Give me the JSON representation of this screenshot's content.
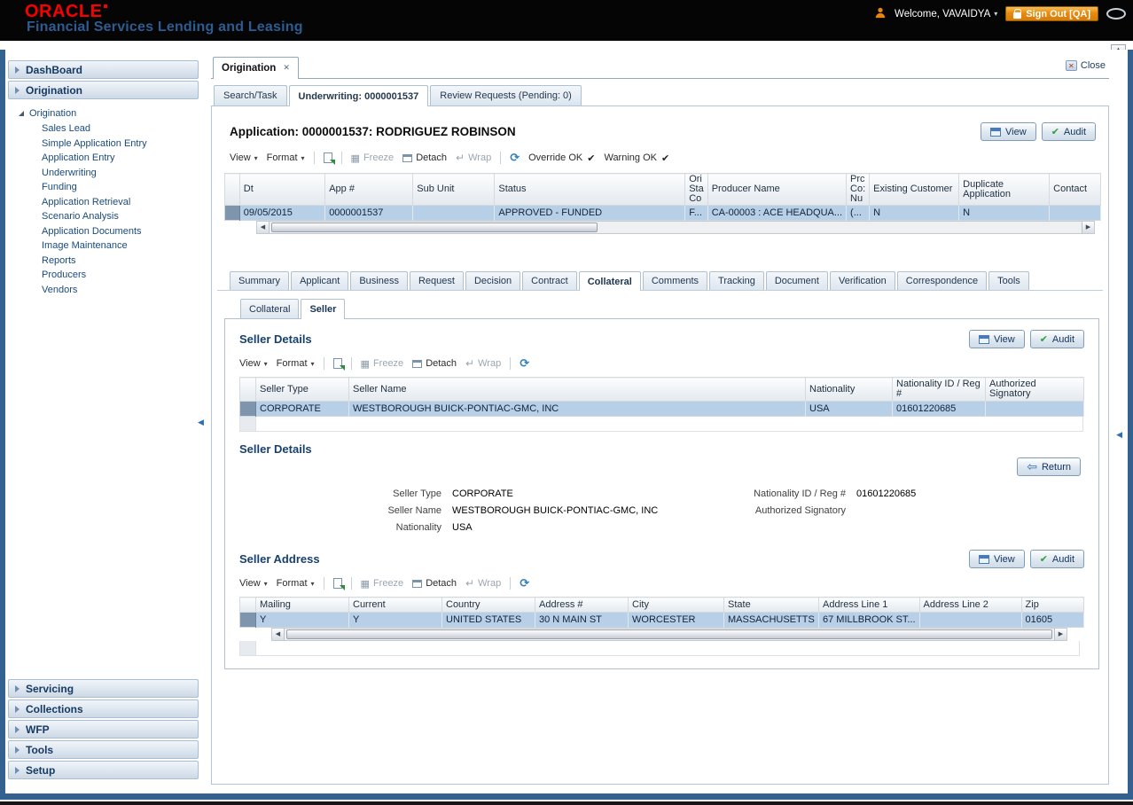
{
  "header": {
    "logo": "ORACLE",
    "product_line": "Financial Services Lending and Leasing",
    "welcome_label": "Welcome, VAVAIDYA",
    "sign_out_label": "Sign Out [QA]"
  },
  "sidebar": {
    "dashboard": "DashBoard",
    "origination": "Origination",
    "tree_root": "Origination",
    "tree_items": [
      "Sales Lead",
      "Simple Application Entry",
      "Application Entry",
      "Underwriting",
      "Funding",
      "Application Retrieval",
      "Scenario Analysis",
      "Application Documents",
      "Image Maintenance",
      "Reports",
      "Producers",
      "Vendors"
    ],
    "servicing": "Servicing",
    "collections": "Collections",
    "wfp": "WFP",
    "tools": "Tools",
    "setup": "Setup"
  },
  "workspace": {
    "tab_label": "Origination",
    "close_label": "Close",
    "subtabs": [
      "Search/Task",
      "Underwriting: 0000001537",
      "Review Requests (Pending: 0)"
    ]
  },
  "toolbar": {
    "view": "View",
    "format": "Format",
    "freeze": "Freeze",
    "detach": "Detach",
    "wrap": "Wrap"
  },
  "app_section": {
    "title": "Application: 0000001537: RODRIGUEZ ROBINSON",
    "view_button": "View",
    "audit_button": "Audit",
    "override_ok": "Override OK",
    "warning_ok": "Warning OK",
    "columns": [
      "Dt",
      "App #",
      "Sub Unit",
      "Status",
      "Ori Sta Co",
      "Producer Name",
      "Prc Co: Nu",
      "Existing Customer",
      "Duplicate Application",
      "Contact"
    ],
    "row": [
      "09/05/2015",
      "0000001537",
      "",
      "APPROVED - FUNDED",
      "F...",
      "CA-00003 : ACE HEADQUA...",
      "(...",
      "N",
      "N",
      ""
    ]
  },
  "detail_tabs": {
    "labels": [
      "Summary",
      "Applicant",
      "Business",
      "Request",
      "Decision",
      "Contract",
      "Collateral",
      "Comments",
      "Tracking",
      "Document",
      "Verification",
      "Correspondence",
      "Tools"
    ]
  },
  "collateral_subtabs": {
    "labels": [
      "Collateral",
      "Seller"
    ]
  },
  "seller_details": {
    "title": "Seller Details",
    "view_button": "View",
    "audit_button": "Audit",
    "columns": [
      "Seller Type",
      "Seller Name",
      "Nationality",
      "Nationality ID / Reg #",
      "Authorized Signatory"
    ],
    "row": [
      "CORPORATE",
      "WESTBOROUGH BUICK-PONTIAC-GMC, INC",
      "USA",
      "01601220685",
      ""
    ]
  },
  "seller_form": {
    "title": "Seller Details",
    "return_button": "Return",
    "seller_type_label": "Seller Type",
    "seller_type_value": "CORPORATE",
    "seller_name_label": "Seller Name",
    "seller_name_value": "WESTBOROUGH BUICK-PONTIAC-GMC, INC",
    "nationality_label": "Nationality",
    "nationality_value": "USA",
    "nat_id_label": "Nationality ID / Reg #",
    "nat_id_value": "01601220685",
    "auth_sig_label": "Authorized Signatory",
    "auth_sig_value": ""
  },
  "seller_address": {
    "title": "Seller Address",
    "view_button": "View",
    "audit_button": "Audit",
    "columns": [
      "Mailing",
      "Current",
      "Country",
      "Address #",
      "City",
      "State",
      "Address Line 1",
      "Address Line 2",
      "Zip"
    ],
    "row": [
      "Y",
      "Y",
      "UNITED STATES",
      "30 N MAIN ST",
      "WORCESTER",
      "MASSACHUSETTS",
      "67 MILLBROOK ST...",
      "",
      "01605"
    ]
  }
}
